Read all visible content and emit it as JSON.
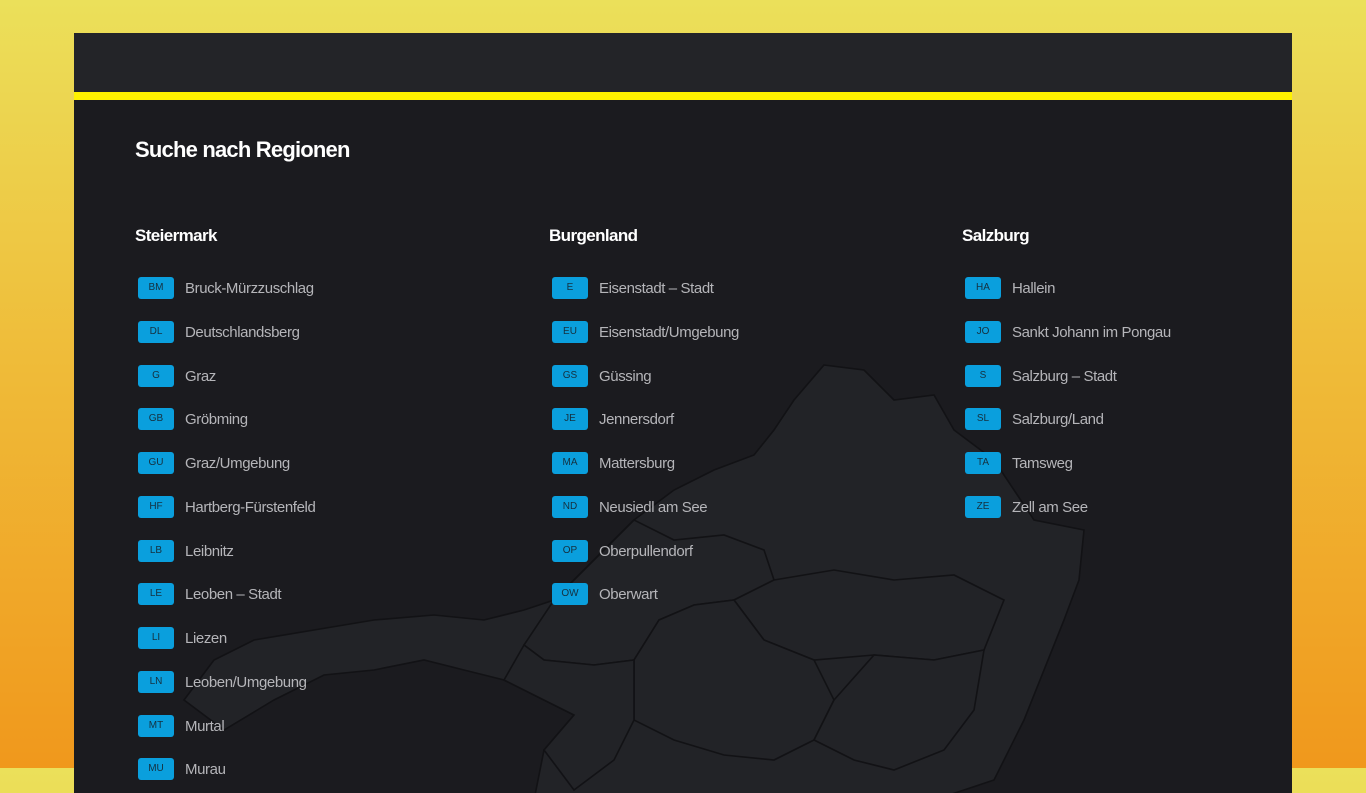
{
  "heading": "Suche nach Regionen",
  "columns": [
    {
      "title": "Steiermark",
      "items": [
        {
          "code": "BM",
          "name": "Bruck-Mürzzuschlag"
        },
        {
          "code": "DL",
          "name": "Deutschlandsberg"
        },
        {
          "code": "G",
          "name": "Graz"
        },
        {
          "code": "GB",
          "name": "Gröbming"
        },
        {
          "code": "GU",
          "name": "Graz/Umgebung"
        },
        {
          "code": "HF",
          "name": "Hartberg-Fürstenfeld"
        },
        {
          "code": "LB",
          "name": "Leibnitz"
        },
        {
          "code": "LE",
          "name": "Leoben – Stadt"
        },
        {
          "code": "LI",
          "name": "Liezen"
        },
        {
          "code": "LN",
          "name": "Leoben/Umgebung"
        },
        {
          "code": "MT",
          "name": "Murtal"
        },
        {
          "code": "MU",
          "name": "Murau"
        }
      ]
    },
    {
      "title": "Burgenland",
      "items": [
        {
          "code": "E",
          "name": "Eisenstadt – Stadt"
        },
        {
          "code": "EU",
          "name": "Eisenstadt/Umgebung"
        },
        {
          "code": "GS",
          "name": "Güssing"
        },
        {
          "code": "JE",
          "name": "Jennersdorf"
        },
        {
          "code": "MA",
          "name": "Mattersburg"
        },
        {
          "code": "ND",
          "name": "Neusiedl am See"
        },
        {
          "code": "OP",
          "name": "Oberpullendorf"
        },
        {
          "code": "OW",
          "name": "Oberwart"
        }
      ]
    },
    {
      "title": "Salzburg",
      "items": [
        {
          "code": "HA",
          "name": "Hallein"
        },
        {
          "code": "JO",
          "name": "Sankt Johann im Pongau"
        },
        {
          "code": "S",
          "name": "Salzburg – Stadt"
        },
        {
          "code": "SL",
          "name": "Salzburg/Land"
        },
        {
          "code": "TA",
          "name": "Tamsweg"
        },
        {
          "code": "ZE",
          "name": "Zell am See"
        }
      ]
    }
  ],
  "colors": {
    "accent": "#fff200",
    "badge": "#0a9fdd",
    "panel": "#1b1b1f",
    "topbar": "#232428"
  }
}
